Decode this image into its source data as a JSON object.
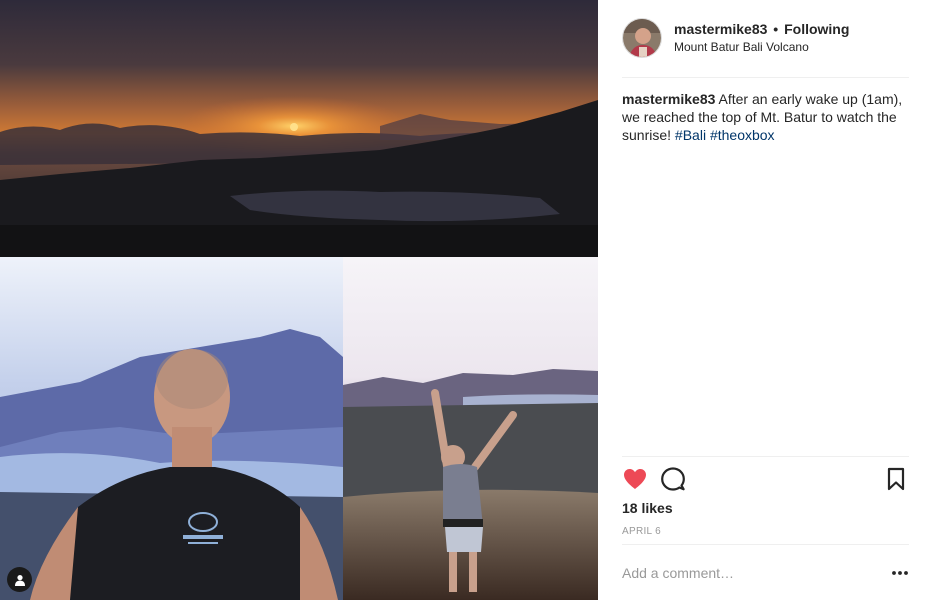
{
  "post": {
    "username": "mastermike83",
    "separator": "•",
    "follow_status": "Following",
    "location": "Mount Batur Bali Volcano",
    "caption": {
      "username": "mastermike83",
      "text": " After an early wake up (1am), we reached the top of Mt. Batur to watch the sunrise! ",
      "hashtags": [
        "#Bali",
        "#theoxbox"
      ]
    },
    "likes": "18 likes",
    "date": "APRIL 6",
    "comment_placeholder": "Add a comment…"
  },
  "icons": {
    "like": "heart-filled-icon",
    "comment": "speech-bubble-icon",
    "save": "bookmark-icon",
    "more": "ellipsis-icon",
    "tag": "user-tag-icon"
  },
  "colors": {
    "like_red": "#ed4956",
    "hashtag": "#003569",
    "muted": "#999999",
    "divider": "#efefef"
  }
}
